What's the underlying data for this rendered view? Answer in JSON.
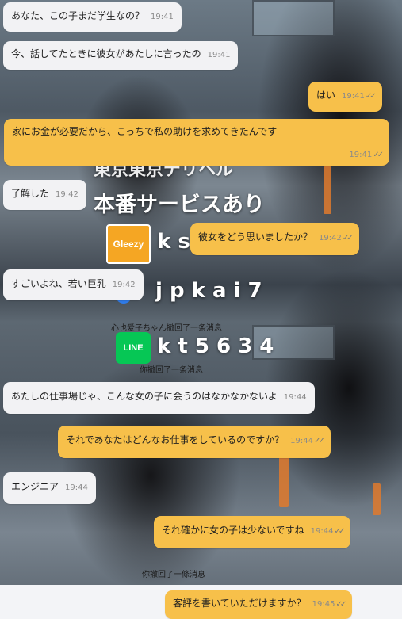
{
  "messages": [
    {
      "text": "あなた、この子まだ学生なの？",
      "time": "19:41"
    },
    {
      "text": "今、話してたときに彼女があたしに言ったの",
      "time": "19:41"
    },
    {
      "text": "はい",
      "time": "19:41"
    },
    {
      "text": "家にお金が必要だから、こっちで私の助けを求めてきたんです",
      "time": "19:41"
    },
    {
      "text": "了解した",
      "time": "19:42"
    },
    {
      "text": "彼女をどう思いましたか？",
      "time": "19:42"
    },
    {
      "text": "すごいよね、若い巨乳",
      "time": "19:42"
    },
    {
      "text": "あたしの仕事場じゃ、こんな女の子に会うのはなかなかないよ",
      "time": "19:44"
    },
    {
      "text": "それであなたはどんなお仕事をしているのですか？",
      "time": "19:44"
    },
    {
      "text": "エンジニア",
      "time": "19:44"
    },
    {
      "text": "それ確かに女の子は少ないですね",
      "time": "19:44"
    },
    {
      "text": "客評を書いていただけますか？",
      "time": "19:45"
    }
  ],
  "read_mark": "✓✓",
  "overlay": {
    "line1": "東京東京デリヘル",
    "line2": "本番サービスあり",
    "gleezy_logo": "Gleezy",
    "gleezy_id": "k s",
    "blue_id": "j p k a  i 7",
    "line_logo": "LINE",
    "line_id": "k t 5 6 3 4",
    "recall_1": "心也爱子ちゃん撤回了一条消息",
    "recall_2": "你撤回了一条消息",
    "recall_3": "你撤回了一條消息"
  },
  "colors": {
    "sent_bubble": "#f7c04a",
    "received_bubble": "#f2f2f4",
    "line_green": "#06c755",
    "gleezy_orange": "#f5a623"
  }
}
